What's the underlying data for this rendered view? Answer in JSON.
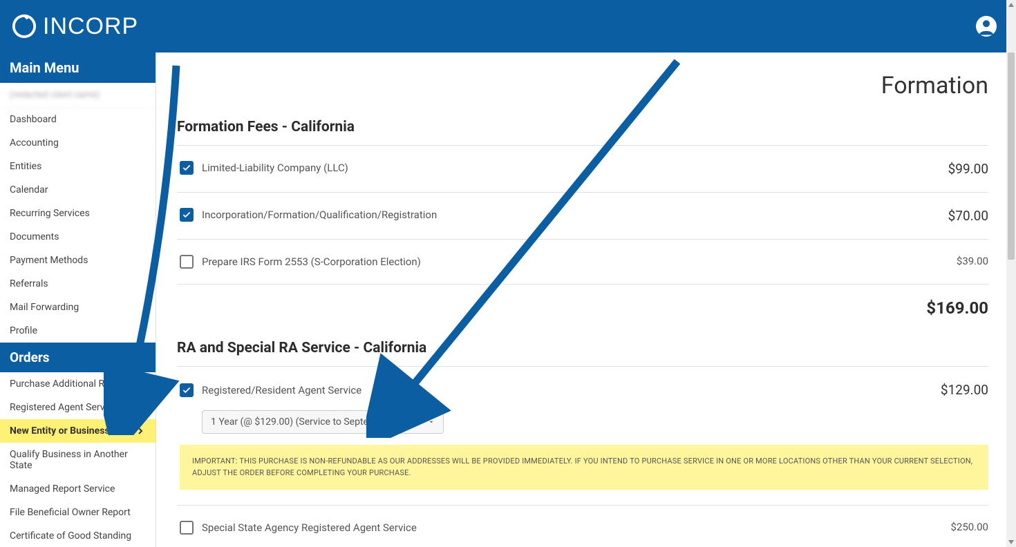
{
  "brand": {
    "name": "INCORP"
  },
  "sidebar": {
    "main_menu_label": "Main Menu",
    "client_name": "(redacted client name)",
    "items": [
      {
        "label": "Dashboard"
      },
      {
        "label": "Accounting"
      },
      {
        "label": "Entities"
      },
      {
        "label": "Calendar"
      },
      {
        "label": "Recurring Services"
      },
      {
        "label": "Documents"
      },
      {
        "label": "Payment Methods"
      },
      {
        "label": "Referrals"
      },
      {
        "label": "Mail Forwarding"
      },
      {
        "label": "Profile"
      }
    ],
    "orders_label": "Orders",
    "order_items": [
      {
        "label": "Purchase Additional RA Years",
        "highlight": false
      },
      {
        "label": "Registered Agent Service",
        "highlight": false
      },
      {
        "label": "New Entity or Business",
        "highlight": true
      },
      {
        "label": "Qualify Business in Another State",
        "highlight": false
      },
      {
        "label": "Managed Report Service",
        "highlight": false
      },
      {
        "label": "File Beneficial Owner Report",
        "highlight": false
      },
      {
        "label": "Certificate of Good Standing",
        "highlight": false
      }
    ]
  },
  "page": {
    "title": "Formation",
    "formation_fees": {
      "title": "Formation Fees - California",
      "rows": [
        {
          "label": "Limited-Liability Company (LLC)",
          "checked": true,
          "price": "$99.00"
        },
        {
          "label": "Incorporation/Formation/Qualification/Registration",
          "checked": true,
          "price": "$70.00"
        },
        {
          "label": "Prepare IRS Form 2553 (S-Corporation Election)",
          "checked": false,
          "price": "$39.00"
        }
      ],
      "subtotal": "$169.00"
    },
    "ra_service": {
      "title": "RA and Special RA Service - California",
      "rows": [
        {
          "label": "Registered/Resident Agent Service",
          "checked": true,
          "price": "$129.00",
          "select": "1 Year (@ $129.00) (Service to September 2025)"
        },
        {
          "label": "Special State Agency Registered Agent Service",
          "checked": false,
          "price": "$250.00"
        }
      ],
      "notice": "IMPORTANT: THIS PURCHASE IS NON-REFUNDABLE AS OUR ADDRESSES WILL BE PROVIDED IMMEDIATELY. IF YOU INTEND TO PURCHASE SERVICE IN ONE OR MORE LOCATIONS OTHER THAN YOUR CURRENT SELECTION, ADJUST THE ORDER BEFORE COMPLETING YOUR PURCHASE."
    }
  }
}
